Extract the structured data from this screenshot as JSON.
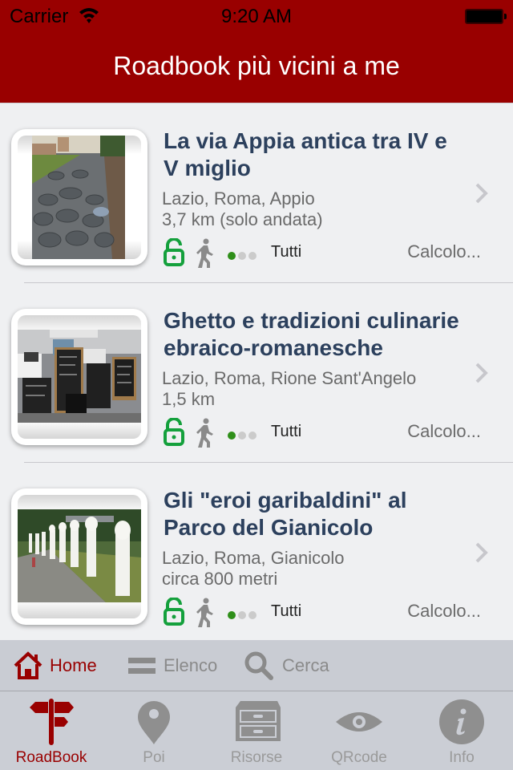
{
  "status_bar": {
    "carrier": "Carrier",
    "time": "9:20 AM",
    "icons": [
      "wifi-icon",
      "battery-icon"
    ]
  },
  "header": {
    "title": "Roadbook più vicini a me"
  },
  "colors": {
    "brand": "#990000",
    "title_text": "#2c405d",
    "unlock_green": "#14a03c",
    "difficulty_on": "#2f8f1a",
    "inactive_gray": "#8a8a8a"
  },
  "roadbooks": [
    {
      "title_line1": "La via Appia antica tra IV e",
      "title_line2": "V miglio",
      "location": "Lazio, Roma, Appio",
      "distance": "3,7 km (solo andata)",
      "mode_icon": "walking-icon",
      "lock_icon": "unlocked-icon",
      "difficulty": 1,
      "difficulty_max": 3,
      "audience": "Tutti",
      "status": "Calcolo...",
      "image": "cobblestone-ancient-road-photo"
    },
    {
      "title_line1": "Ghetto e tradizioni culinarie",
      "title_line2": "ebraico-romanesche",
      "location": "Lazio, Roma, Rione Sant'Angelo",
      "distance": "1,5 km",
      "mode_icon": "walking-icon",
      "lock_icon": "unlocked-icon",
      "difficulty": 1,
      "difficulty_max": 3,
      "audience": "Tutti",
      "status": "Calcolo...",
      "image": "restaurant-chalkboards-photo"
    },
    {
      "title_line1": "Gli \"eroi garibaldini\" al",
      "title_line2": "Parco del Gianicolo",
      "location": "Lazio, Roma, Gianicolo",
      "distance": "circa 800 metri",
      "mode_icon": "walking-icon",
      "lock_icon": "unlocked-icon",
      "difficulty": 1,
      "difficulty_max": 3,
      "audience": "Tutti",
      "status": "Calcolo...",
      "image": "park-busts-photo"
    }
  ],
  "segments": [
    {
      "label": "Home",
      "icon": "home-icon",
      "active": true
    },
    {
      "label": "Elenco",
      "icon": "list-icon",
      "active": false
    },
    {
      "label": "Cerca",
      "icon": "search-icon",
      "active": false
    }
  ],
  "tabs": [
    {
      "label": "RoadBook",
      "icon": "signpost-icon",
      "active": true
    },
    {
      "label": "Poi",
      "icon": "map-pin-icon",
      "active": false
    },
    {
      "label": "Risorse",
      "icon": "drawer-cabinet-icon",
      "active": false
    },
    {
      "label": "QRcode",
      "icon": "eye-icon",
      "active": false
    },
    {
      "label": "Info",
      "icon": "info-icon",
      "active": false
    }
  ]
}
